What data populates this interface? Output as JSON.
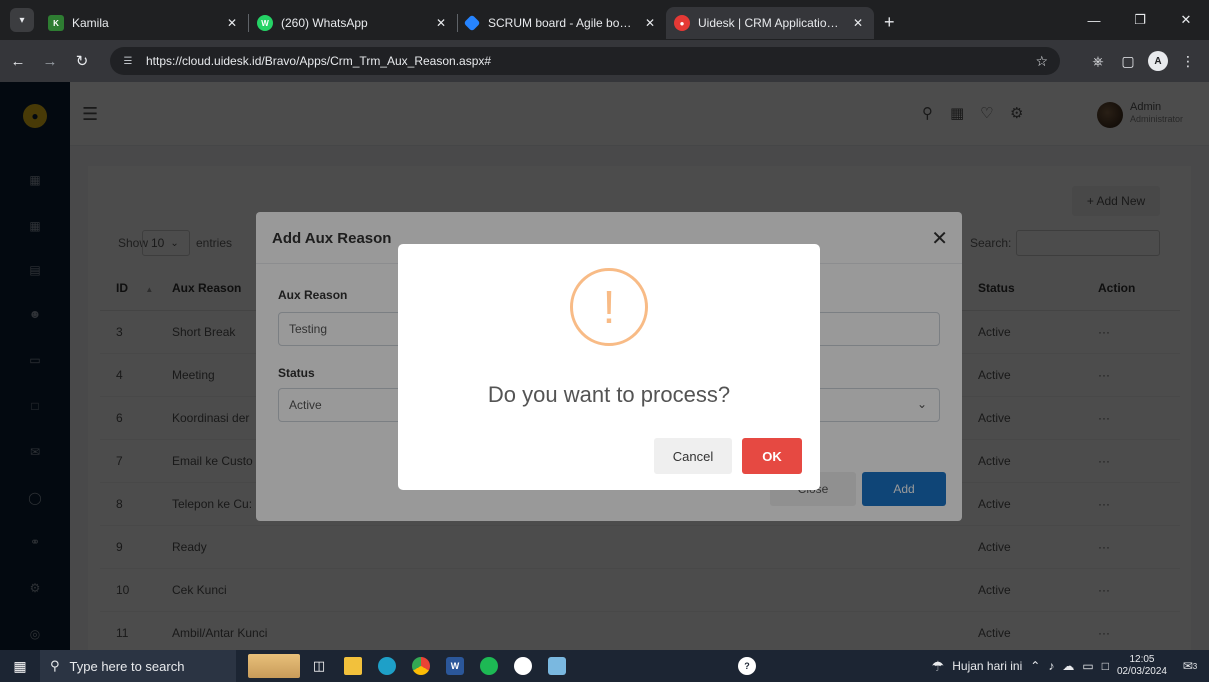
{
  "browser": {
    "tabs": [
      {
        "label": "Kamila",
        "favicon": "kamila-favicon",
        "color": "#2e7d32"
      },
      {
        "label": "(260) WhatsApp",
        "favicon": "whatsapp-icon",
        "color": "#25d366"
      },
      {
        "label": "SCRUM board - Agile board - J",
        "favicon": "jira-icon",
        "color": "#2684ff"
      },
      {
        "label": "Uidesk | CRM Application Syste",
        "favicon": "uidesk-icon",
        "color": "#e53935"
      }
    ],
    "active_tab": 3,
    "url": "https://cloud.uidesk.id/Bravo/Apps/Crm_Trm_Aux_Reason.aspx#",
    "profile_initial": "A"
  },
  "app": {
    "user_name": "Admin",
    "user_role": "Administrator",
    "add_new_label": "+ Add New",
    "show_label": "Show",
    "entries_value": "10",
    "entries_label": "entries",
    "search_label": "Search:",
    "columns": {
      "id": "ID",
      "reason": "Aux Reason",
      "status": "Status",
      "action": "Action"
    },
    "rows": [
      {
        "id": "3",
        "reason": "Short Break",
        "status": "Active",
        "action": "···"
      },
      {
        "id": "4",
        "reason": "Meeting",
        "status": "Active",
        "action": "···"
      },
      {
        "id": "6",
        "reason": "Koordinasi der",
        "status": "Active",
        "action": "···"
      },
      {
        "id": "7",
        "reason": "Email ke Custo",
        "status": "Active",
        "action": "···"
      },
      {
        "id": "8",
        "reason": "Telepon ke Cu:",
        "status": "Active",
        "action": "···"
      },
      {
        "id": "9",
        "reason": "Ready",
        "status": "Active",
        "action": "···"
      },
      {
        "id": "10",
        "reason": "Cek Kunci",
        "status": "Active",
        "action": "···"
      },
      {
        "id": "11",
        "reason": "Ambil/Antar Kunci",
        "status": "Active",
        "action": "···"
      }
    ]
  },
  "modal": {
    "title": "Add Aux Reason",
    "reason_label": "Aux Reason",
    "reason_value": "Testing",
    "status_label": "Status",
    "status_value": "Active",
    "close_label": "Close",
    "add_label": "Add"
  },
  "alert": {
    "icon": "!",
    "message": "Do you want to process?",
    "cancel_label": "Cancel",
    "ok_label": "OK",
    "ok_color": "#e64942",
    "icon_color": "#f8bb86"
  },
  "taskbar": {
    "search_placeholder": "Type here to search",
    "weather": "Hujan hari ini",
    "time": "12:05",
    "date": "02/03/2024",
    "notifications": "3"
  }
}
